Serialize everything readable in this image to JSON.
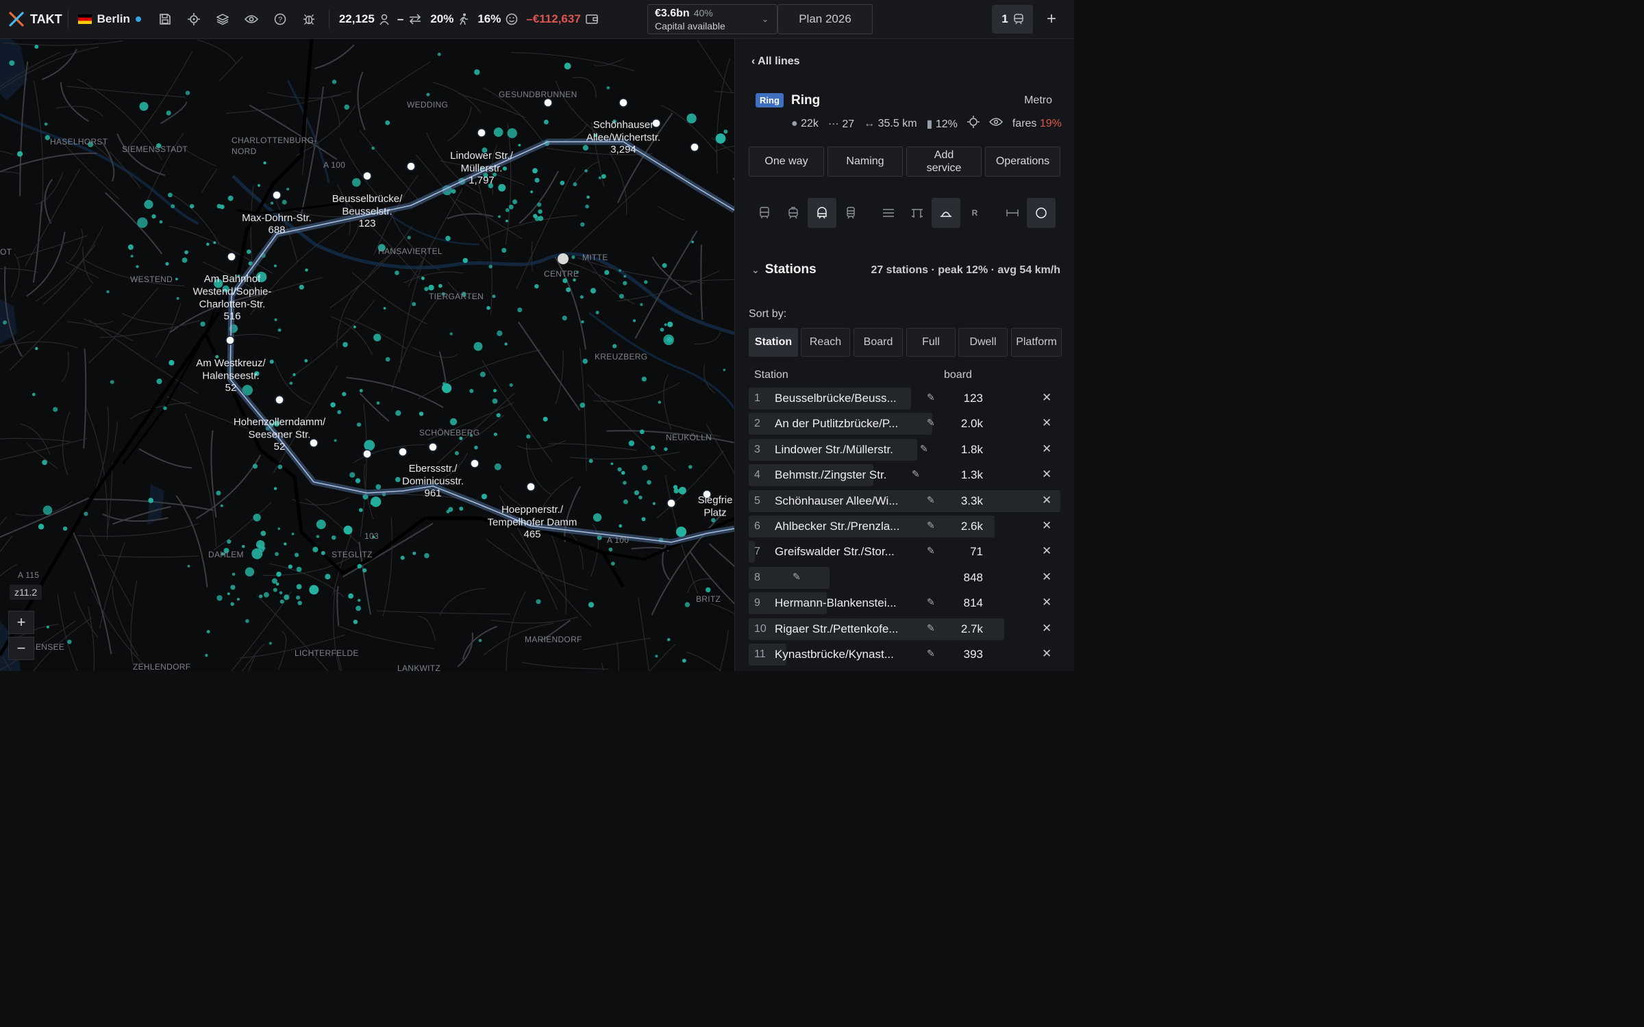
{
  "topbar": {
    "app_name": "TAKT",
    "city": "Berlin",
    "population": "22,125",
    "transfers": "–",
    "walk_pct": "20%",
    "satisfaction_pct": "16%",
    "balance": "–€112,637",
    "capital_amount": "€3.6bn",
    "capital_pct": "40%",
    "capital_label": "Capital available",
    "plan": "Plan 2026",
    "lines_count": "1"
  },
  "map": {
    "zoom": "z11.2",
    "zoom_in": "+",
    "zoom_out": "−",
    "districts": [
      "HASELHORST",
      "SIEMENSSTADT",
      "CHARLOTTENBURG-",
      "NORD",
      "WEDDING",
      "GESUNDBRUNNEN",
      "WESTEND",
      "HANSAVIERTEL",
      "TIERGARTEN",
      "MITTE",
      "CENTRE",
      "KREUZBERG",
      "SCHÖNEBERG",
      "NEUKÖLLN",
      "DAHLEM",
      "STEGLITZ",
      "BRITZ",
      "MARIENDORF",
      "LICHTERFELDE",
      "ZEHLENDORF",
      "ENSEE",
      "A 100",
      "A 115",
      "A 100",
      "103",
      "LANKWITZ",
      "OT"
    ],
    "stations": [
      {
        "name1": "Max-Dohrn-Str.",
        "name2": "",
        "name3": "",
        "count": "688"
      },
      {
        "name1": "Beusselbrücke/",
        "name2": "Beusselstr.",
        "name3": "",
        "count": "123"
      },
      {
        "name1": "Lindower Str./",
        "name2": "Müllerstr.",
        "name3": "",
        "count": "1,797"
      },
      {
        "name1": "Schönhauser",
        "name2": "Allee/Wichertstr.",
        "name3": "",
        "count": "3,294"
      },
      {
        "name1": "Am Bahnhof",
        "name2": "Westend/Sophie-",
        "name3": "Charlotten-Str.",
        "count": "516"
      },
      {
        "name1": "Am Westkreuz/",
        "name2": "Halenseestr.",
        "name3": "",
        "count": "52"
      },
      {
        "name1": "Hohenzollerndamm/",
        "name2": "Seesener Str.",
        "name3": "",
        "count": "52"
      },
      {
        "name1": "Eberssstr./",
        "name2": "Dominicusstr.",
        "name3": "",
        "count": "961"
      },
      {
        "name1": "Hoeppnerstr./",
        "name2": "Tempelhofer Damm",
        "name3": "",
        "count": "465"
      },
      {
        "name1": "Siegfrie",
        "name2": "Platz",
        "name3": "",
        "count": ""
      }
    ]
  },
  "panel": {
    "back": "‹ All lines",
    "line_badge": "Ring",
    "line_name": "Ring",
    "mode": "Metro",
    "stats": {
      "riders": "22k",
      "stations": "27",
      "length": "35.5 km",
      "load": "12%",
      "fares_label": "fares",
      "fares_pct": "19%"
    },
    "actions": [
      "One way",
      "Naming",
      "Add service",
      "Operations"
    ],
    "stations_title": "Stations",
    "stations_summary": "27 stations · peak 12% · avg 54 km/h",
    "sort_label": "Sort by:",
    "sort_options": [
      "Station",
      "Reach",
      "Board",
      "Full",
      "Dwell",
      "Platform"
    ],
    "col_station": "Station",
    "col_board": "board",
    "rows": [
      {
        "num": "1",
        "name": "Beusselbrücke/Beuss...",
        "val": "123",
        "frac": 0.52
      },
      {
        "num": "2",
        "name": "An der Putlitzbrücke/P...",
        "val": "2.0k",
        "frac": 0.59
      },
      {
        "num": "3",
        "name": "Lindower Str./Müllerstr.",
        "val": "1.8k",
        "frac": 0.54
      },
      {
        "num": "4",
        "name": "Behmstr./Zingster Str.",
        "val": "1.3k",
        "frac": 0.4
      },
      {
        "num": "5",
        "name": "Schönhauser Allee/Wi...",
        "val": "3.3k",
        "frac": 1.0
      },
      {
        "num": "6",
        "name": "Ahlbecker Str./Prenzla...",
        "val": "2.6k",
        "frac": 0.79
      },
      {
        "num": "7",
        "name": "Greifswalder Str./Stor...",
        "val": "71",
        "frac": 0.02
      },
      {
        "num": "8",
        "name": "",
        "val": "848",
        "frac": 0.26
      },
      {
        "num": "9",
        "name": "Hermann-Blankenstei...",
        "val": "814",
        "frac": 0.25
      },
      {
        "num": "10",
        "name": "Rigaer Str./Pettenkofe...",
        "val": "2.7k",
        "frac": 0.82
      },
      {
        "num": "11",
        "name": "Kynastbrücke/Kynast...",
        "val": "393",
        "frac": 0.12
      }
    ]
  }
}
